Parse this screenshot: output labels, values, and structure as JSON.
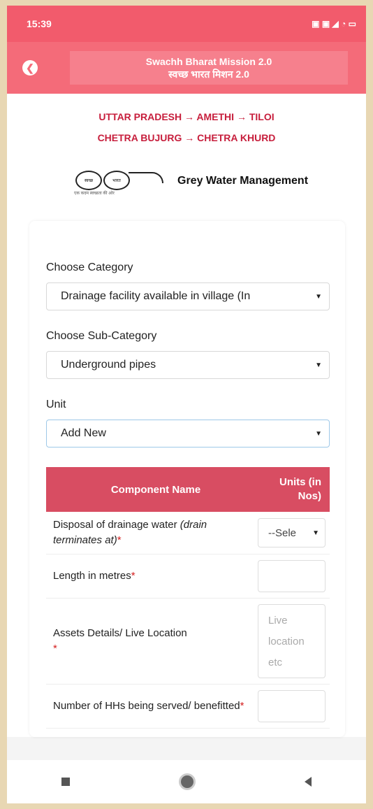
{
  "status": {
    "time": "15:39",
    "icons_text": "▣ ▣ ◢ ◔ ▭"
  },
  "appbar": {
    "title_line1": "Swachh Bharat Mission 2.0",
    "title_line2": "स्वच्छ भारत मिशन 2.0"
  },
  "breadcrumb": {
    "line1": "UTTAR PRADESH → AMETHI → TILOI",
    "line2": "CHETRA BUJURG → CHETRA KHURD"
  },
  "brand": {
    "logo_left_text": "स्वच्छ",
    "logo_right_text": "भारत",
    "logo_caption": "एक कदम स्वच्छता की ओर",
    "title": "Grey Water Management"
  },
  "form": {
    "category_label": "Choose Category",
    "category_value": "Drainage facility available in village (In",
    "subcategory_label": "Choose Sub-Category",
    "subcategory_value": "Underground pipes",
    "unit_label": "Unit",
    "unit_value": "Add New"
  },
  "table": {
    "col_name": "Component Name",
    "col_units_line1": "Units (in",
    "col_units_line2": "Nos)",
    "rows": [
      {
        "name": "Disposal of drainage water",
        "name_italic": "(drain terminates at)",
        "select_value": "--Sele"
      },
      {
        "name": "Length in metres"
      },
      {
        "name": "Assets Details/ Live Location",
        "placeholder_line1": "Live",
        "placeholder_line2": "location",
        "placeholder_line3": "etc"
      },
      {
        "name": "Number of HHs being served/ benefitted"
      }
    ],
    "required_mark": "*"
  },
  "colors": {
    "statusbar": "#f25b6c",
    "appbar": "#f46b79",
    "breadcrumb": "#c71e3c",
    "table_header": "#d84d62"
  }
}
